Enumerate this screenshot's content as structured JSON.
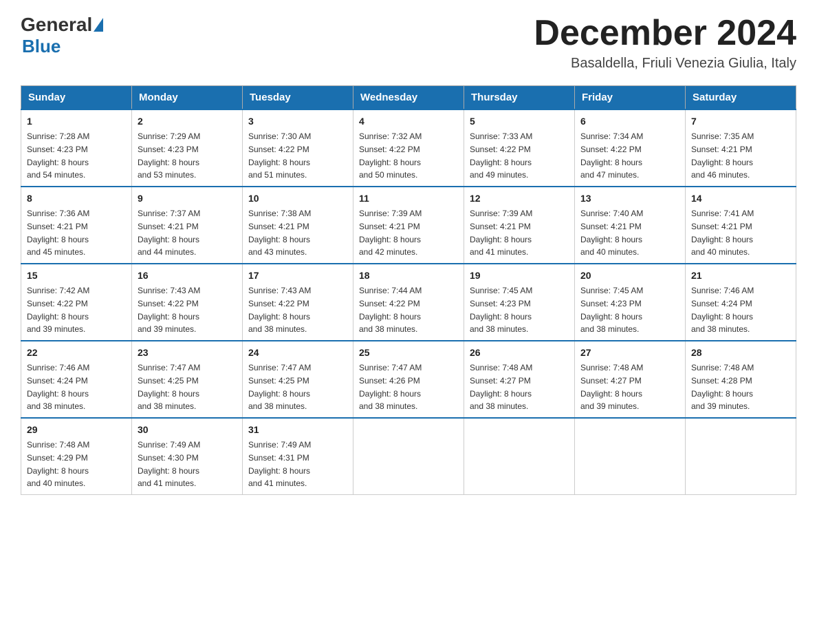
{
  "header": {
    "logo": {
      "general": "General",
      "blue": "Blue"
    },
    "title": "December 2024",
    "location": "Basaldella, Friuli Venezia Giulia, Italy"
  },
  "weekdays": [
    "Sunday",
    "Monday",
    "Tuesday",
    "Wednesday",
    "Thursday",
    "Friday",
    "Saturday"
  ],
  "weeks": [
    [
      {
        "day": "1",
        "sunrise": "7:28 AM",
        "sunset": "4:23 PM",
        "daylight": "8 hours and 54 minutes."
      },
      {
        "day": "2",
        "sunrise": "7:29 AM",
        "sunset": "4:23 PM",
        "daylight": "8 hours and 53 minutes."
      },
      {
        "day": "3",
        "sunrise": "7:30 AM",
        "sunset": "4:22 PM",
        "daylight": "8 hours and 51 minutes."
      },
      {
        "day": "4",
        "sunrise": "7:32 AM",
        "sunset": "4:22 PM",
        "daylight": "8 hours and 50 minutes."
      },
      {
        "day": "5",
        "sunrise": "7:33 AM",
        "sunset": "4:22 PM",
        "daylight": "8 hours and 49 minutes."
      },
      {
        "day": "6",
        "sunrise": "7:34 AM",
        "sunset": "4:22 PM",
        "daylight": "8 hours and 47 minutes."
      },
      {
        "day": "7",
        "sunrise": "7:35 AM",
        "sunset": "4:21 PM",
        "daylight": "8 hours and 46 minutes."
      }
    ],
    [
      {
        "day": "8",
        "sunrise": "7:36 AM",
        "sunset": "4:21 PM",
        "daylight": "8 hours and 45 minutes."
      },
      {
        "day": "9",
        "sunrise": "7:37 AM",
        "sunset": "4:21 PM",
        "daylight": "8 hours and 44 minutes."
      },
      {
        "day": "10",
        "sunrise": "7:38 AM",
        "sunset": "4:21 PM",
        "daylight": "8 hours and 43 minutes."
      },
      {
        "day": "11",
        "sunrise": "7:39 AM",
        "sunset": "4:21 PM",
        "daylight": "8 hours and 42 minutes."
      },
      {
        "day": "12",
        "sunrise": "7:39 AM",
        "sunset": "4:21 PM",
        "daylight": "8 hours and 41 minutes."
      },
      {
        "day": "13",
        "sunrise": "7:40 AM",
        "sunset": "4:21 PM",
        "daylight": "8 hours and 40 minutes."
      },
      {
        "day": "14",
        "sunrise": "7:41 AM",
        "sunset": "4:21 PM",
        "daylight": "8 hours and 40 minutes."
      }
    ],
    [
      {
        "day": "15",
        "sunrise": "7:42 AM",
        "sunset": "4:22 PM",
        "daylight": "8 hours and 39 minutes."
      },
      {
        "day": "16",
        "sunrise": "7:43 AM",
        "sunset": "4:22 PM",
        "daylight": "8 hours and 39 minutes."
      },
      {
        "day": "17",
        "sunrise": "7:43 AM",
        "sunset": "4:22 PM",
        "daylight": "8 hours and 38 minutes."
      },
      {
        "day": "18",
        "sunrise": "7:44 AM",
        "sunset": "4:22 PM",
        "daylight": "8 hours and 38 minutes."
      },
      {
        "day": "19",
        "sunrise": "7:45 AM",
        "sunset": "4:23 PM",
        "daylight": "8 hours and 38 minutes."
      },
      {
        "day": "20",
        "sunrise": "7:45 AM",
        "sunset": "4:23 PM",
        "daylight": "8 hours and 38 minutes."
      },
      {
        "day": "21",
        "sunrise": "7:46 AM",
        "sunset": "4:24 PM",
        "daylight": "8 hours and 38 minutes."
      }
    ],
    [
      {
        "day": "22",
        "sunrise": "7:46 AM",
        "sunset": "4:24 PM",
        "daylight": "8 hours and 38 minutes."
      },
      {
        "day": "23",
        "sunrise": "7:47 AM",
        "sunset": "4:25 PM",
        "daylight": "8 hours and 38 minutes."
      },
      {
        "day": "24",
        "sunrise": "7:47 AM",
        "sunset": "4:25 PM",
        "daylight": "8 hours and 38 minutes."
      },
      {
        "day": "25",
        "sunrise": "7:47 AM",
        "sunset": "4:26 PM",
        "daylight": "8 hours and 38 minutes."
      },
      {
        "day": "26",
        "sunrise": "7:48 AM",
        "sunset": "4:27 PM",
        "daylight": "8 hours and 38 minutes."
      },
      {
        "day": "27",
        "sunrise": "7:48 AM",
        "sunset": "4:27 PM",
        "daylight": "8 hours and 39 minutes."
      },
      {
        "day": "28",
        "sunrise": "7:48 AM",
        "sunset": "4:28 PM",
        "daylight": "8 hours and 39 minutes."
      }
    ],
    [
      {
        "day": "29",
        "sunrise": "7:48 AM",
        "sunset": "4:29 PM",
        "daylight": "8 hours and 40 minutes."
      },
      {
        "day": "30",
        "sunrise": "7:49 AM",
        "sunset": "4:30 PM",
        "daylight": "8 hours and 41 minutes."
      },
      {
        "day": "31",
        "sunrise": "7:49 AM",
        "sunset": "4:31 PM",
        "daylight": "8 hours and 41 minutes."
      },
      null,
      null,
      null,
      null
    ]
  ],
  "labels": {
    "sunrise": "Sunrise:",
    "sunset": "Sunset:",
    "daylight": "Daylight:"
  }
}
